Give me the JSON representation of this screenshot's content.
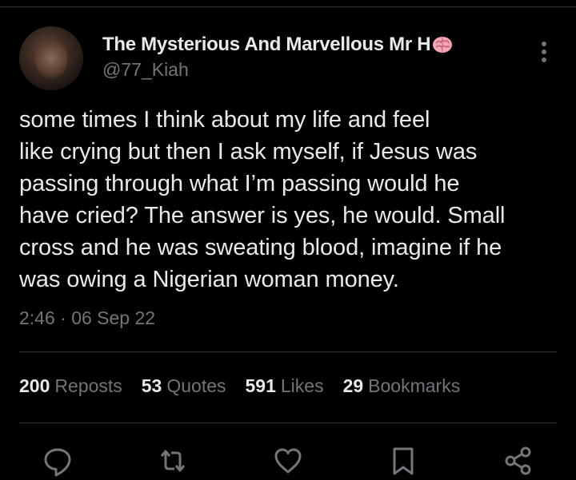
{
  "tweet": {
    "author_display_name": "The Mysterious And Marvellous Mr H",
    "author_emoji_icon": "brain-icon",
    "author_handle": "@77_Kiah",
    "text": "some times I think about my life and feel\nlike crying but then I ask myself, if Jesus was\npassing through what I’m passing would he\nhave cried? The answer is yes, he would. Small\ncross and he was sweating blood, imagine if he\nwas owing a Nigerian woman money.",
    "timestamp": "2:46 · 06 Sep 22"
  },
  "stats": [
    {
      "count": "200",
      "label": "Reposts"
    },
    {
      "count": "53",
      "label": "Quotes"
    },
    {
      "count": "591",
      "label": "Likes"
    },
    {
      "count": "29",
      "label": "Bookmarks"
    }
  ],
  "actions": [
    "reply-icon",
    "repost-icon",
    "like-icon",
    "bookmark-icon",
    "share-icon"
  ],
  "colors": {
    "background": "#000000",
    "text_primary": "#e7e9ea",
    "text_secondary": "#71767b",
    "divider": "#2f3336",
    "brain": "#f4a6b5"
  }
}
